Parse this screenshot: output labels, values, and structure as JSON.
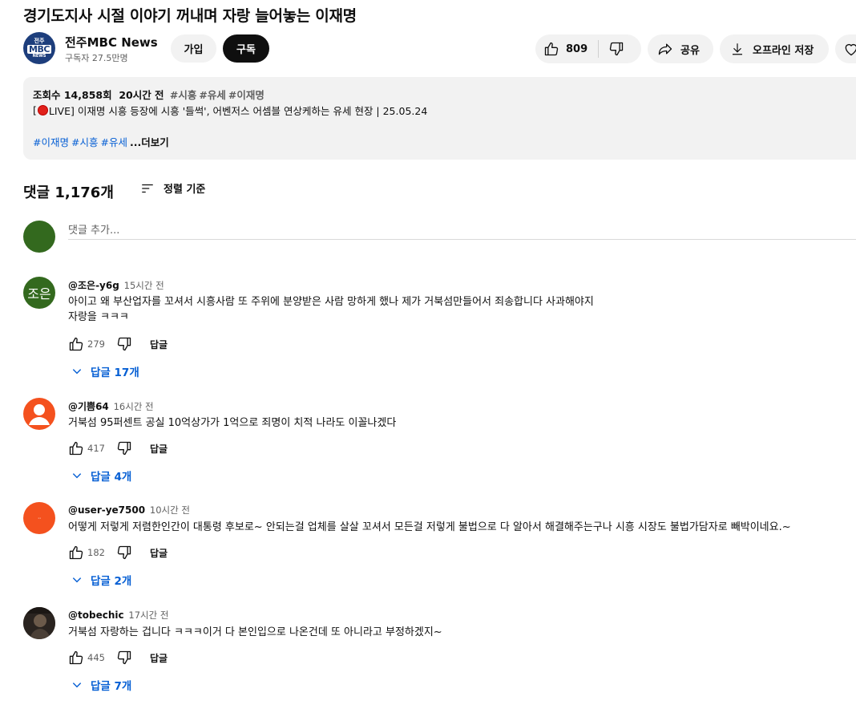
{
  "video": {
    "title": "경기도지사 시절 이야기 꺼내며 자랑 늘어놓는 이재명"
  },
  "channel": {
    "name": "전주MBC News",
    "subscribers": "구독자 27.5만명",
    "avatar_top": "전주",
    "avatar_mid": "MBC",
    "avatar_bottom": "NEWS",
    "join_label": "가입",
    "subscribe_label": "구독"
  },
  "actions": {
    "like_count": "809",
    "share_label": "공유",
    "offline_label": "오프라인 저장"
  },
  "description": {
    "views": "조회수 14,858회",
    "time": "20시간 전",
    "meta_tags": [
      "#시흥",
      "#유세",
      "#이재명"
    ],
    "line_prefix": "[",
    "line_text": "LIVE] 이재명 시흥 등장에 시흥 '들썩', 어벤저스 어셈블 연상케하는 유세 현장 | 25.05.24",
    "tags": [
      "#이재명",
      "#시흥",
      "#유세"
    ],
    "more_label": "...더보기"
  },
  "comments_header": {
    "count": "댓글 1,176개",
    "sort_label": "정렬 기준"
  },
  "add_comment": {
    "placeholder": "댓글 추가..."
  },
  "comments": [
    {
      "author": "@조은-y6g",
      "time": "15시간 전",
      "avatar_text": "조은",
      "avatar_color": "#33691e",
      "lines": [
        "아이고 왜 부산업자를 꼬셔서 시흥사람 또 주위에 분양받은 사람 망하게 했나  제가 거북섬만들어서 죄송합니다 사과해야지",
        "자랑을  ㅋㅋㅋ"
      ],
      "likes": "279",
      "reply_label": "답글",
      "replies": "답글 17개"
    },
    {
      "author": "@기쁨64",
      "time": "16시간 전",
      "avatar_text": "",
      "avatar_color": "#f4511e",
      "lines": [
        "거북섬 95퍼센트 공실 10억상가가 1억으로 죄명이 치적 나라도 이꼴나겠다"
      ],
      "likes": "417",
      "reply_label": "답글",
      "replies": "답글 4개"
    },
    {
      "author": "@user-ye7500",
      "time": "10시간 전",
      "avatar_text": "ᐧᐧ",
      "avatar_color": "#f4511e",
      "lines": [
        "어떻게 저렇게 저렴한인간이 대통령 후보로~ 안되는걸   업체를 살살 꼬셔서  모든걸 저렇게  불법으로 다 알아서 해결해주는구나  시흥 시장도 불법가담자로 빼박이네요.~"
      ],
      "likes": "182",
      "reply_label": "답글",
      "replies": "답글 2개"
    },
    {
      "author": "@tobechic",
      "time": "17시간 전",
      "avatar_text": "",
      "avatar_color": "#3b3226",
      "lines": [
        "거북섬 자랑하는 겁니다 ㅋㅋㅋ이거 다 본인입으로 나온건데 또 아니라고 부정하겠지~"
      ],
      "likes": "445",
      "reply_label": "답글",
      "replies": "답글 7개"
    }
  ]
}
